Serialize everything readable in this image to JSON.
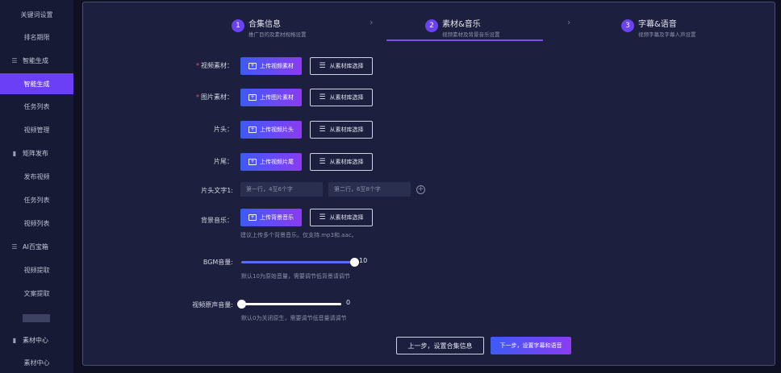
{
  "sidebar": {
    "items": [
      {
        "label": "关键词设置",
        "type": "item"
      },
      {
        "label": "排名期限",
        "type": "item"
      },
      {
        "label": "智能生成",
        "type": "group",
        "icon": "menu-icon"
      },
      {
        "label": "智能生成",
        "type": "item",
        "active": true
      },
      {
        "label": "任务列表",
        "type": "item"
      },
      {
        "label": "视频管理",
        "type": "item"
      },
      {
        "label": "矩阵发布",
        "type": "group",
        "icon": "bar-chart-icon"
      },
      {
        "label": "发布视频",
        "type": "item"
      },
      {
        "label": "任务列表",
        "type": "item"
      },
      {
        "label": "视频列表",
        "type": "item"
      },
      {
        "label": "AI百宝箱",
        "type": "group",
        "icon": "menu-icon"
      },
      {
        "label": "视频提取",
        "type": "item"
      },
      {
        "label": "文案提取",
        "type": "item"
      },
      {
        "label": "",
        "type": "blurred"
      },
      {
        "label": "素材中心",
        "type": "group",
        "icon": "bar-chart-icon"
      },
      {
        "label": "素材中心",
        "type": "item"
      }
    ]
  },
  "steps": [
    {
      "num": "1",
      "title": "合集信息",
      "sub": "推广目的及素材规格设置"
    },
    {
      "num": "2",
      "title": "素材&音乐",
      "sub": "视频素材及背景音乐设置",
      "active": true
    },
    {
      "num": "3",
      "title": "字幕&语音",
      "sub": "视频字幕及字幕人声设置"
    }
  ],
  "form": {
    "video": {
      "label": "视频素材：",
      "upload": "上传视频素材",
      "library": "从素材库选择",
      "required": true
    },
    "image": {
      "label": "图片素材：",
      "upload": "上传图片素材",
      "library": "从素材库选择",
      "required": true
    },
    "intro": {
      "label": "片头：",
      "upload": "上传视频片头",
      "library": "从素材库选择"
    },
    "outro": {
      "label": "片尾：",
      "upload": "上传视频片尾",
      "library": "从素材库选择"
    },
    "intro_text": {
      "label": "片头文字1:",
      "placeholder1": "第一行，4至6个字",
      "placeholder2": "第二行，6至8个字"
    },
    "bgm": {
      "label": "背景音乐：",
      "upload": "上传背景音乐",
      "library": "从素材库选择",
      "hint": "建议上传多个背景音乐。仅支持.mp3和.aac。"
    },
    "bgm_volume": {
      "label": "BGM音量:",
      "value": "10",
      "fraction": 1.0,
      "hint": "默认10为原始音量，需要调节低背景请调节"
    },
    "video_volume": {
      "label": "视频原声音量:",
      "value": "0",
      "fraction": 0.0,
      "hint": "默认0为关闭原生，需要调节低音量请调节"
    }
  },
  "footer": {
    "prev": "上一步，设置合集信息",
    "next": "下一步，设置字幕和语音"
  },
  "colors": {
    "accent": "#6b42f0",
    "background": "#0f1122",
    "panel": "#1c1f3d",
    "required": "#ff4d5a"
  }
}
